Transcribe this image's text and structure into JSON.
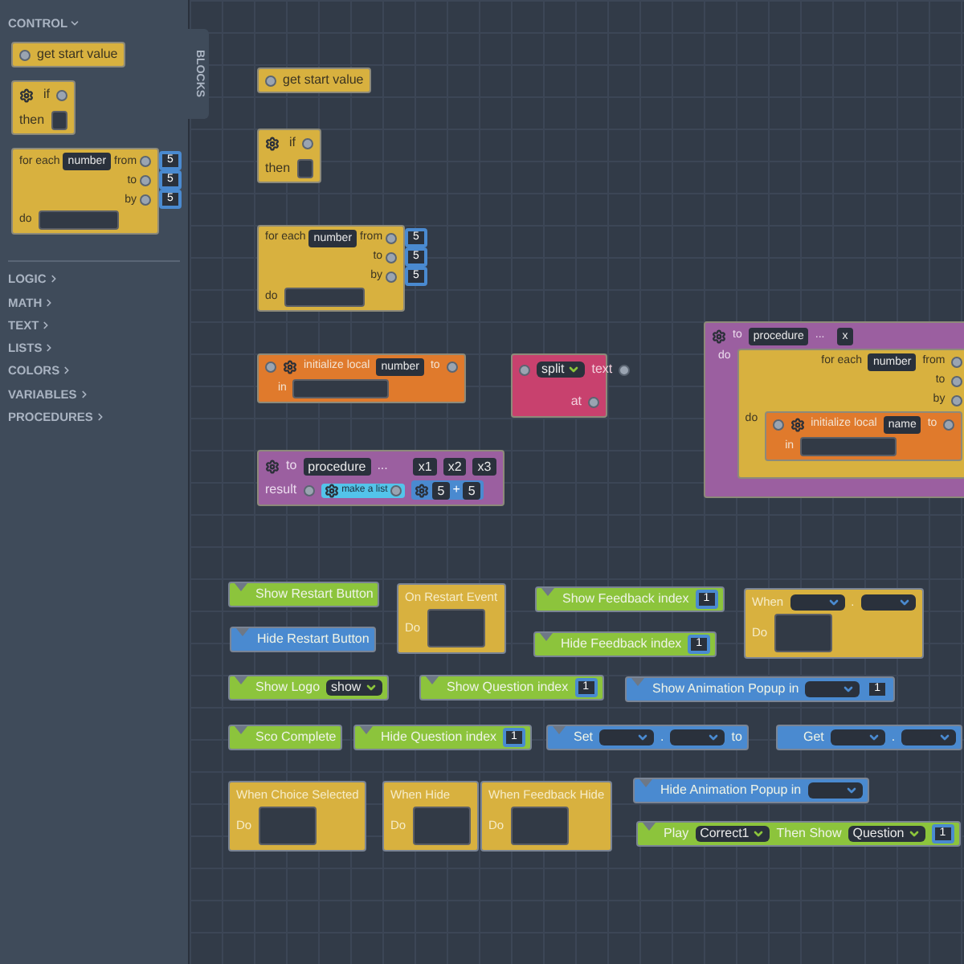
{
  "sidebar": {
    "tab": "BLOCKS",
    "open_category": {
      "label": "CONTROL",
      "expanded": true
    },
    "flyout": [
      {
        "kind": "get",
        "text": "get start value"
      },
      {
        "kind": "if",
        "if": "if",
        "then": "then"
      },
      {
        "kind": "foreach",
        "label": "for each",
        "var": "number",
        "from": "from",
        "to": "to",
        "by": "by",
        "do": "do",
        "values": [
          "5",
          "5",
          "5"
        ]
      }
    ],
    "categories": [
      {
        "label": "LOGIC",
        "expanded": false
      },
      {
        "label": "MATH",
        "expanded": false
      },
      {
        "label": "TEXT",
        "expanded": false
      },
      {
        "label": "LISTS",
        "expanded": false
      },
      {
        "label": "COLORS",
        "expanded": false
      },
      {
        "label": "VARIABLES",
        "expanded": false
      },
      {
        "label": "PROCEDURES",
        "expanded": false
      }
    ]
  },
  "blocks": [
    {
      "kind": "get",
      "text": "get start value"
    },
    {
      "kind": "if",
      "if": "if",
      "then": "then"
    },
    {
      "kind": "foreach",
      "label": "for each",
      "var": "number",
      "from": "from",
      "to": "to",
      "by": "by",
      "do": "do",
      "values": [
        "5",
        "5",
        "5"
      ]
    },
    {
      "kind": "init",
      "label": "initialize local",
      "var": "number",
      "to": "to",
      "in": "in"
    },
    {
      "kind": "split",
      "dropdown": "split",
      "text": "text",
      "at": "at"
    },
    {
      "kind": "procedure",
      "to": "to",
      "name": "procedure",
      "ellipsis": "...",
      "params": [
        "x1",
        "x2",
        "x3"
      ],
      "result": "result",
      "list": "make a list",
      "math": [
        "5",
        "+",
        "5"
      ]
    },
    {
      "kind": "nested",
      "to": "to",
      "name": "procedure",
      "ellipsis": "...",
      "params": [
        "x"
      ],
      "do": "do",
      "loop": {
        "label": "for each",
        "var": "number",
        "from": "from",
        "to": "to",
        "by": "by",
        "do": "do"
      },
      "init": {
        "label": "initialize local",
        "var": "name",
        "to": "to",
        "in": "in"
      }
    },
    {
      "kind": "statement",
      "color": "#8cc43c",
      "parts": [
        {
          "kind": "label",
          "text": "Show Restart Button"
        }
      ]
    },
    {
      "kind": "statement",
      "color": "#4a8ad0",
      "parts": [
        {
          "kind": "label",
          "text": "Hide Restart Button"
        }
      ]
    },
    {
      "kind": "event",
      "parts": [
        {
          "kind": "label",
          "text": "On Restart Event"
        }
      ],
      "do": "Do"
    },
    {
      "kind": "statement",
      "color": "#8cc43c",
      "parts": [
        {
          "kind": "label",
          "text": "Show Feedback index"
        },
        {
          "kind": "socket",
          "text": "1"
        }
      ]
    },
    {
      "kind": "statement",
      "color": "#8cc43c",
      "parts": [
        {
          "kind": "label",
          "text": "Hide Feedback index"
        },
        {
          "kind": "socket",
          "text": "1"
        }
      ]
    },
    {
      "kind": "event",
      "parts": [
        {
          "kind": "label",
          "text": "When"
        },
        {
          "kind": "dropdown"
        },
        {
          "kind": "label",
          "text": "."
        },
        {
          "kind": "dropdown"
        }
      ],
      "do": "Do"
    },
    {
      "kind": "statement",
      "color": "#8cc43c",
      "parts": [
        {
          "kind": "label",
          "text": "Show Logo"
        },
        {
          "kind": "dropdown",
          "text": "show"
        }
      ]
    },
    {
      "kind": "statement",
      "color": "#8cc43c",
      "parts": [
        {
          "kind": "label",
          "text": "Show Question index"
        },
        {
          "kind": "socket",
          "text": "1"
        }
      ]
    },
    {
      "kind": "statement",
      "color": "#4a8ad0",
      "parts": [
        {
          "kind": "label",
          "text": "Show Animation Popup in"
        },
        {
          "kind": "dropdown"
        },
        {
          "kind": "socket",
          "text": "1"
        }
      ]
    },
    {
      "kind": "statement",
      "color": "#8cc43c",
      "parts": [
        {
          "kind": "label",
          "text": "Sco Complete"
        }
      ]
    },
    {
      "kind": "statement",
      "color": "#8cc43c",
      "parts": [
        {
          "kind": "label",
          "text": "Hide Question index"
        },
        {
          "kind": "socket",
          "text": "1"
        }
      ]
    },
    {
      "kind": "statement",
      "color": "#4a8ad0",
      "parts": [
        {
          "kind": "label",
          "text": "Set"
        },
        {
          "kind": "dropdown"
        },
        {
          "kind": "label",
          "text": "."
        },
        {
          "kind": "dropdown"
        },
        {
          "kind": "label",
          "text": "to"
        }
      ]
    },
    {
      "kind": "reporter",
      "color": "#4a8ad0",
      "parts": [
        {
          "kind": "label",
          "text": "Get"
        },
        {
          "kind": "dropdown"
        },
        {
          "kind": "label",
          "text": "."
        },
        {
          "kind": "dropdown"
        }
      ]
    },
    {
      "kind": "event",
      "parts": [
        {
          "kind": "label",
          "text": "When Choice Selected"
        }
      ],
      "do": "Do"
    },
    {
      "kind": "event",
      "parts": [
        {
          "kind": "label",
          "text": "When Hide"
        }
      ],
      "do": "Do"
    },
    {
      "kind": "event",
      "parts": [
        {
          "kind": "label",
          "text": "When Feedback Hide"
        }
      ],
      "do": "Do"
    },
    {
      "kind": "statement",
      "color": "#4a8ad0",
      "parts": [
        {
          "kind": "label",
          "text": "Hide Animation Popup in"
        },
        {
          "kind": "dropdown"
        }
      ]
    },
    {
      "kind": "statement",
      "color": "#8cc43c",
      "parts": [
        {
          "kind": "label",
          "text": "Play"
        },
        {
          "kind": "dropdown",
          "text": "Correct1"
        },
        {
          "kind": "label",
          "text": "Then Show"
        },
        {
          "kind": "dropdown",
          "text": "Question"
        },
        {
          "kind": "socket",
          "text": "1"
        }
      ]
    }
  ]
}
